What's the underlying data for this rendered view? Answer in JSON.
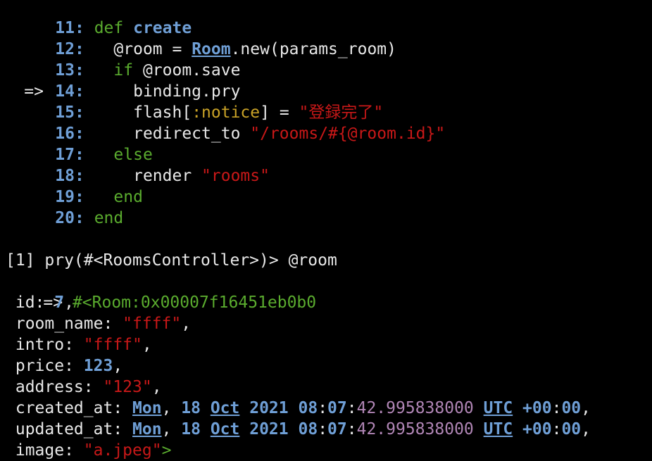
{
  "code": {
    "lines": [
      {
        "arrow": "",
        "num": "11",
        "tokens": [
          [
            "g",
            "def "
          ],
          [
            "b",
            "create"
          ]
        ]
      },
      {
        "arrow": "",
        "num": "12",
        "tokens": [
          [
            "w",
            "  @room = "
          ],
          [
            "bu",
            "Room"
          ],
          [
            "w",
            ".new(params_room)"
          ]
        ]
      },
      {
        "arrow": "",
        "num": "13",
        "tokens": [
          [
            "w",
            "  "
          ],
          [
            "g",
            "if"
          ],
          [
            "w",
            " @room.save"
          ]
        ]
      },
      {
        "arrow": "=>",
        "num": "14",
        "tokens": [
          [
            "w",
            "    binding.pry"
          ]
        ]
      },
      {
        "arrow": "",
        "num": "15",
        "tokens": [
          [
            "w",
            "    flash["
          ],
          [
            "y",
            ":notice"
          ],
          [
            "w",
            "] = "
          ],
          [
            "r",
            "\"登録完了\""
          ]
        ]
      },
      {
        "arrow": "",
        "num": "16",
        "tokens": [
          [
            "w",
            "    redirect_to "
          ],
          [
            "r",
            "\"/rooms/#{@room.id}\""
          ]
        ]
      },
      {
        "arrow": "",
        "num": "17",
        "tokens": [
          [
            "w",
            "  "
          ],
          [
            "g",
            "else"
          ]
        ]
      },
      {
        "arrow": "",
        "num": "18",
        "tokens": [
          [
            "w",
            "    render "
          ],
          [
            "r",
            "\"rooms\""
          ]
        ]
      },
      {
        "arrow": "",
        "num": "19",
        "tokens": [
          [
            "w",
            "  "
          ],
          [
            "g",
            "end"
          ]
        ]
      },
      {
        "arrow": "",
        "num": "20",
        "tokens": [
          [
            "g",
            "end"
          ]
        ]
      }
    ]
  },
  "prompt": {
    "text": "[1] pry(#<RoomsController>)> @room"
  },
  "result": {
    "arrow": "=>",
    "object": " #<Room:0x00007f16451eb0b0"
  },
  "attributes": [
    {
      "tokens": [
        [
          "w",
          " id: "
        ],
        [
          "b",
          "7"
        ],
        [
          "w",
          ","
        ]
      ]
    },
    {
      "tokens": [
        [
          "w",
          " room_name: "
        ],
        [
          "r",
          "\"ffff\""
        ],
        [
          "w",
          ","
        ]
      ]
    },
    {
      "tokens": [
        [
          "w",
          " intro: "
        ],
        [
          "r",
          "\"ffff\""
        ],
        [
          "w",
          ","
        ]
      ]
    },
    {
      "tokens": [
        [
          "w",
          " price: "
        ],
        [
          "b",
          "123"
        ],
        [
          "w",
          ","
        ]
      ]
    },
    {
      "tokens": [
        [
          "w",
          " address: "
        ],
        [
          "r",
          "\"123\""
        ],
        [
          "w",
          ","
        ]
      ]
    },
    {
      "tokens": [
        [
          "w",
          " created_at: "
        ],
        [
          "bu",
          "Mon"
        ],
        [
          "w",
          ", "
        ],
        [
          "b",
          "18"
        ],
        [
          "w",
          " "
        ],
        [
          "bu",
          "Oct"
        ],
        [
          "w",
          " "
        ],
        [
          "b",
          "2021"
        ],
        [
          "w",
          " "
        ],
        [
          "b",
          "08"
        ],
        [
          "w",
          ":"
        ],
        [
          "b",
          "07"
        ],
        [
          "w",
          ":"
        ],
        [
          "p",
          "42.995838000"
        ],
        [
          "w",
          " "
        ],
        [
          "bu",
          "UTC"
        ],
        [
          "w",
          " "
        ],
        [
          "b",
          "+00"
        ],
        [
          "w",
          ":"
        ],
        [
          "b",
          "00"
        ],
        [
          "w",
          ","
        ]
      ]
    },
    {
      "tokens": [
        [
          "w",
          " updated_at: "
        ],
        [
          "bu",
          "Mon"
        ],
        [
          "w",
          ", "
        ],
        [
          "b",
          "18"
        ],
        [
          "w",
          " "
        ],
        [
          "bu",
          "Oct"
        ],
        [
          "w",
          " "
        ],
        [
          "b",
          "2021"
        ],
        [
          "w",
          " "
        ],
        [
          "b",
          "08"
        ],
        [
          "w",
          ":"
        ],
        [
          "b",
          "07"
        ],
        [
          "w",
          ":"
        ],
        [
          "p",
          "42.995838000"
        ],
        [
          "w",
          " "
        ],
        [
          "bu",
          "UTC"
        ],
        [
          "w",
          " "
        ],
        [
          "b",
          "+00"
        ],
        [
          "w",
          ":"
        ],
        [
          "b",
          "00"
        ],
        [
          "w",
          ","
        ]
      ]
    },
    {
      "tokens": [
        [
          "w",
          " image: "
        ],
        [
          "r",
          "\"a.jpeg\""
        ],
        [
          "g",
          ">"
        ]
      ]
    }
  ],
  "colors": {
    "background": "#000000",
    "keyword": "#5aab2e",
    "number_and_linenum": "#6f9fd6",
    "string": "#c81818",
    "symbol": "#c9a227",
    "float": "#b085b5",
    "text": "#e8e8e8"
  }
}
